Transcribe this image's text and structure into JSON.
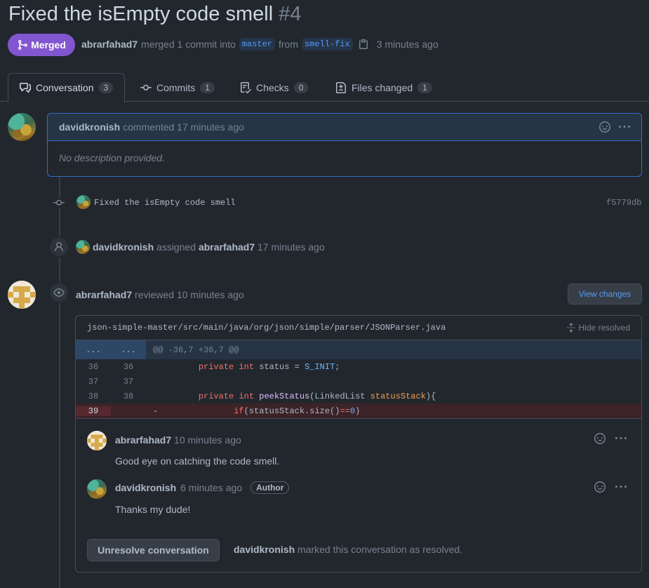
{
  "pr": {
    "title": "Fixed the isEmpty code smell",
    "number": "#4",
    "state": "Merged",
    "author": "abrarfahad7",
    "merged_text": "merged 1 commit into",
    "base_branch": "master",
    "from_text": "from",
    "head_branch": "smell-fix",
    "time": "3 minutes ago",
    "merged_color": "#8256d0"
  },
  "tabs": [
    {
      "label": "Conversation",
      "count": "3",
      "icon": "comment-discussion-icon"
    },
    {
      "label": "Commits",
      "count": "1",
      "icon": "git-commit-icon"
    },
    {
      "label": "Checks",
      "count": "0",
      "icon": "checklist-icon"
    },
    {
      "label": "Files changed",
      "count": "1",
      "icon": "file-diff-icon"
    }
  ],
  "comment": {
    "author": "davidkronish",
    "action": "commented 17 minutes ago",
    "body": "No description provided."
  },
  "commit": {
    "message": "Fixed the isEmpty code smell",
    "sha": "f5779db"
  },
  "assigned": {
    "actor": "davidkronish",
    "verb": "assigned",
    "assignee": "abrarfahad7",
    "time": "17 minutes ago"
  },
  "review": {
    "author": "abrarfahad7",
    "action": "reviewed 10 minutes ago",
    "view_changes_label": "View changes",
    "file_path": "json-simple-master/src/main/java/org/json/simple/parser/JSONParser.java",
    "hide_resolved_label": "Hide resolved",
    "hunk_left": "...",
    "hunk_right": "...",
    "hunk_header": "@@ -36,7 +36,7 @@",
    "lines": [
      {
        "old": "36",
        "new": "36"
      },
      {
        "old": "37",
        "new": "37"
      },
      {
        "old": "38",
        "new": "38"
      },
      {
        "old": "39",
        "new": ""
      }
    ],
    "code": {
      "line36": {
        "kw1": "private",
        "kw2": "int",
        "plain1": " status = ",
        "const": "S_INIT",
        "plain2": ";"
      },
      "line38": {
        "kw1": "private",
        "kw2": "int",
        "fn": "peekStatus",
        "plain1": "(LinkedList ",
        "var": "statusStack",
        "plain2": "){"
      },
      "line39": {
        "marker": "-",
        "kw": "if",
        "plain1": "(statusStack.size()",
        "op": "==",
        "num": "0",
        "plain2": ")"
      }
    },
    "replies": [
      {
        "author": "abrarfahad7",
        "time": "10 minutes ago",
        "body": "Good eye on catching the code smell."
      },
      {
        "author": "davidkronish",
        "time": "6 minutes ago",
        "badge": "Author",
        "body": "Thanks my dude!"
      }
    ],
    "unresolve_label": "Unresolve conversation",
    "resolved_by": "davidkronish",
    "resolved_text": "marked this conversation as resolved."
  }
}
